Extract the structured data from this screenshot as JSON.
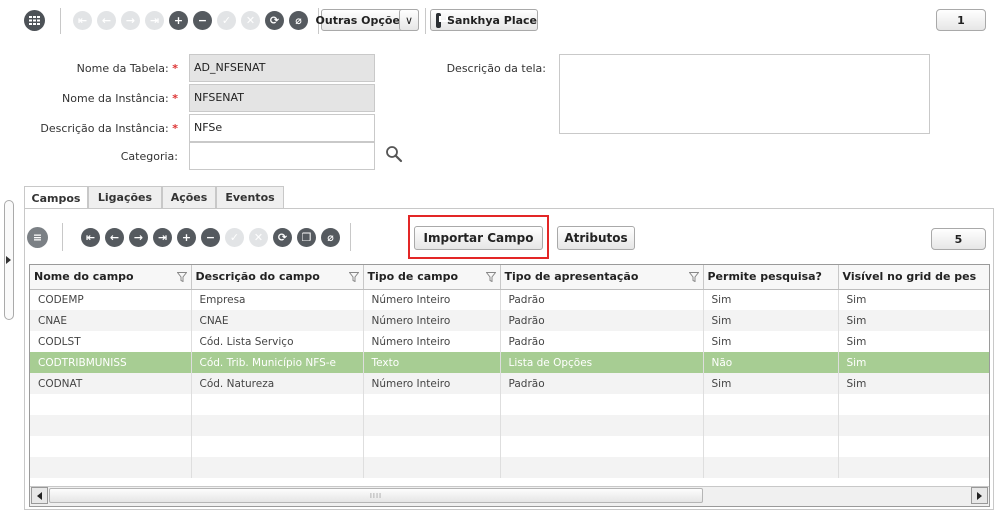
{
  "top_toolbar": {
    "more_options_label": "Outras Opções",
    "more_options_arrow": "∨",
    "sankhya_place_label": "Sankhya Place",
    "record_counter": "1",
    "icons": [
      "grid-icon",
      "first-record-icon",
      "previous-record-icon",
      "next-record-icon",
      "last-record-icon",
      "add-icon",
      "remove-icon",
      "confirm-icon",
      "cancel-icon",
      "refresh-icon",
      "clip-icon"
    ]
  },
  "form": {
    "table_name_label": "Nome da Tabela:",
    "table_name_value": "AD_NFSENAT",
    "instance_name_label": "Nome da Instância:",
    "instance_name_value": "NFSENAT",
    "instance_description_label": "Descrição da Instância:",
    "instance_description_value": "NFSe",
    "category_label": "Categoria:",
    "category_value": "",
    "screen_description_label": "Descrição da tela:",
    "screen_description_value": "",
    "required_mark": "*"
  },
  "tabs": [
    {
      "label": "Campos",
      "active": true
    },
    {
      "label": "Ligações",
      "active": false
    },
    {
      "label": "Ações",
      "active": false
    },
    {
      "label": "Eventos",
      "active": false
    }
  ],
  "grid_toolbar": {
    "import_field_label": "Importar Campo",
    "attributes_label": "Atributos",
    "record_count": "5",
    "highlight_color": "#e32626"
  },
  "grid": {
    "columns": [
      "Nome do campo",
      "Descrição do campo",
      "Tipo de campo",
      "Tipo de apresentação",
      "Permite pesquisa?",
      "Visível no grid de pes"
    ],
    "rows": [
      [
        "CODEMP",
        "Empresa",
        "Número Inteiro",
        "Padrão",
        "Sim",
        "Sim"
      ],
      [
        "CNAE",
        "CNAE",
        "Número Inteiro",
        "Padrão",
        "Sim",
        "Sim"
      ],
      [
        "CODLST",
        "Cód. Lista Serviço",
        "Número Inteiro",
        "Padrão",
        "Sim",
        "Sim"
      ],
      [
        "CODTRIBMUNISS",
        "Cód. Trib. Município NFS-e",
        "Texto",
        "Lista de Opções",
        "Não",
        "Sim"
      ],
      [
        "CODNAT",
        "Cód. Natureza",
        "Número Inteiro",
        "Padrão",
        "Sim",
        "Sim"
      ]
    ],
    "selected_row_index": 3,
    "selected_color": "#a7cd93",
    "scroll_grip": "IIII"
  }
}
